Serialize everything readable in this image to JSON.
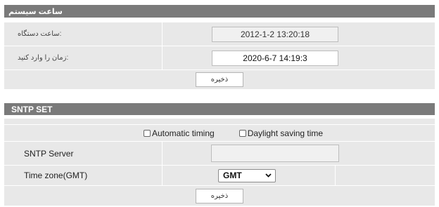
{
  "system_time": {
    "title": "ساعت سیستم",
    "device_time_label": "ساعت دستگاه:",
    "device_time_value": "2012-1-2 13:20:18",
    "enter_time_label": "زمان را وارد کنید:",
    "enter_time_value": "2020-6-7 14:19:3",
    "save_label": "ذخیره"
  },
  "sntp": {
    "title": "SNTP SET",
    "automatic_timing_label": "Automatic timing",
    "automatic_timing_checked": false,
    "daylight_saving_label": "Daylight saving time",
    "daylight_saving_checked": false,
    "server_label": "SNTP Server",
    "server_value": "",
    "timezone_label": "Time zone(GMT)",
    "timezone_selected": "GMT",
    "save_label": "ذخیره"
  }
}
